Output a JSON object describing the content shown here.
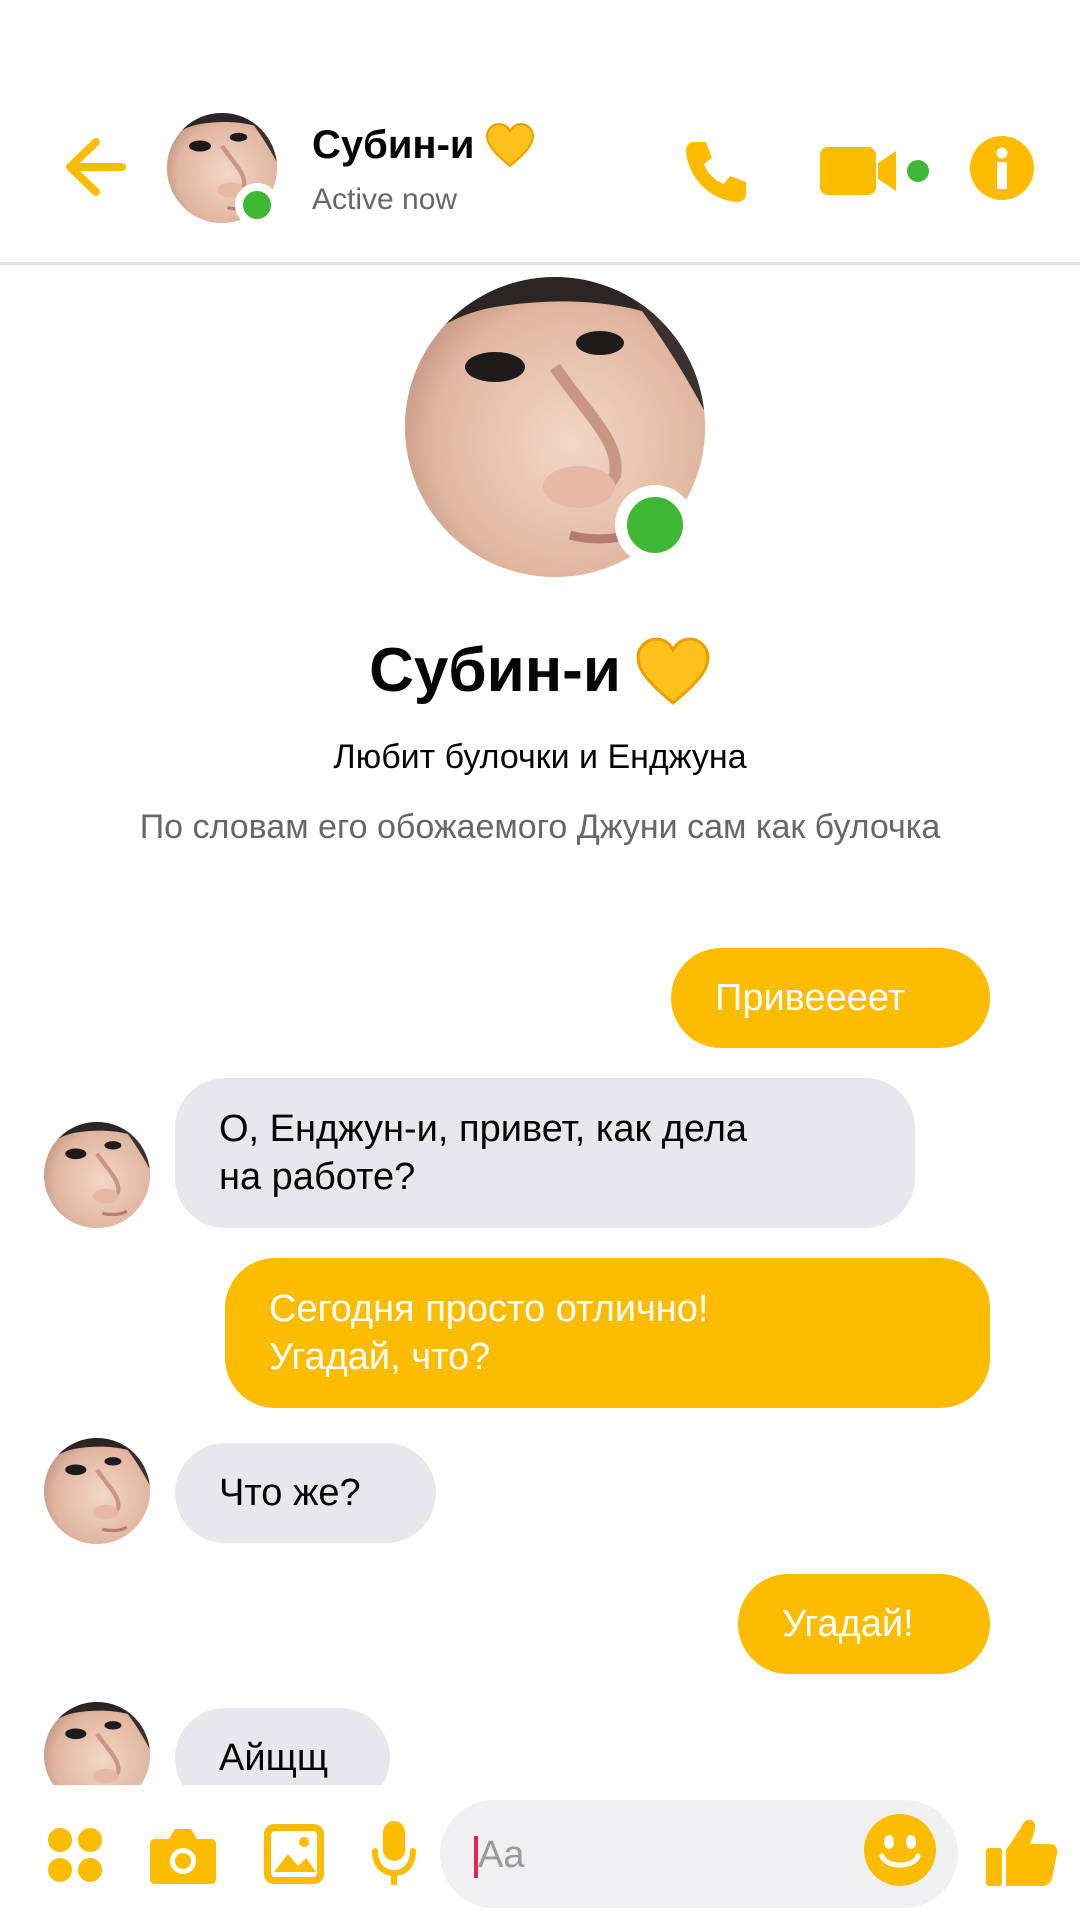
{
  "colors": {
    "accent": "#fcbc00",
    "online": "#3fb836",
    "incoming_bubble": "#e8e7ec"
  },
  "header": {
    "name": "Субин-и",
    "name_emoji": "yellow-heart",
    "status": "Active now",
    "icons": [
      "back-arrow-icon",
      "phone-icon",
      "video-camera-icon",
      "info-icon"
    ]
  },
  "profile": {
    "name": "Субин-и",
    "bio": "Любит булочки и Енджуна",
    "about": "По словам его обожаемого Джуни сам как булочка"
  },
  "messages": [
    {
      "from": "me",
      "text": "Привеееет"
    },
    {
      "from": "them",
      "lines": [
        "О, Енджун-и, привет, как дела",
        "на работе?"
      ]
    },
    {
      "from": "me",
      "lines": [
        "Сегодня просто отлично!",
        "Угадай, что?"
      ]
    },
    {
      "from": "them",
      "text": "Что же?"
    },
    {
      "from": "me",
      "text": "Угадай!"
    },
    {
      "from": "them",
      "text": "Айщщ"
    }
  ],
  "composer": {
    "placeholder": "Aa",
    "icons": [
      "apps-grid-icon",
      "camera-icon",
      "gallery-icon",
      "microphone-icon",
      "emoji-icon",
      "thumbs-up-icon"
    ]
  }
}
